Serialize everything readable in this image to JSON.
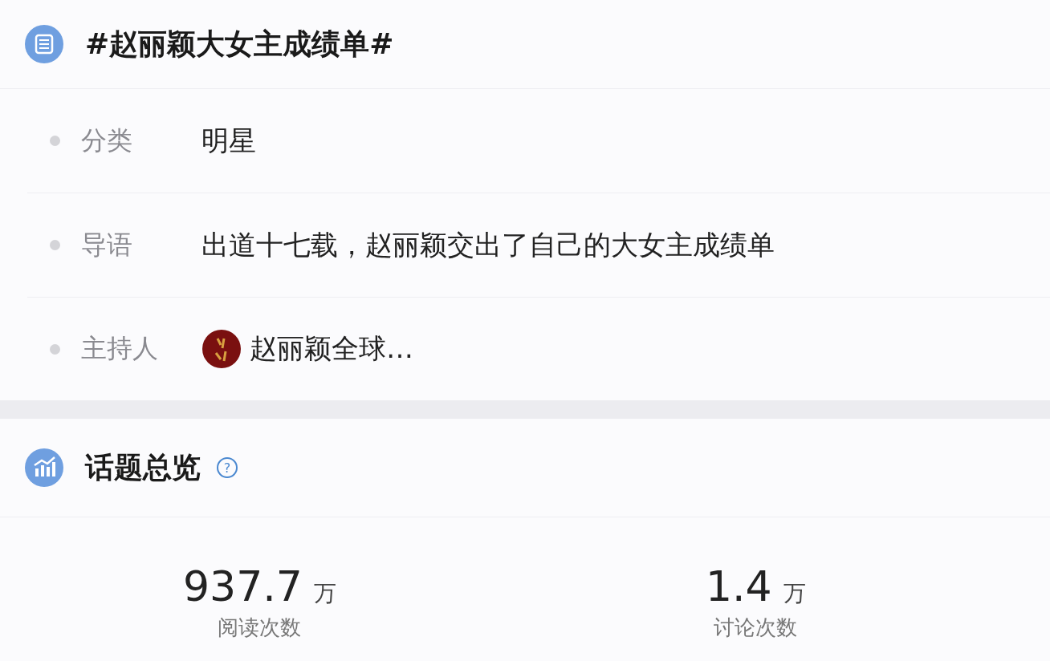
{
  "topic": {
    "title": "#赵丽颖大女主成绩单#"
  },
  "details": [
    {
      "label": "分类",
      "value": "明星",
      "kind": "text"
    },
    {
      "label": "导语",
      "value": "出道十七载，赵丽颖交出了自己的大女主成绩单",
      "kind": "text"
    },
    {
      "label": "主持人",
      "value": "赵丽颖全球…",
      "kind": "host"
    }
  ],
  "overview": {
    "title": "话题总览",
    "help": "?"
  },
  "stats": [
    {
      "number": "937.7",
      "unit": "万",
      "label": "阅读次数"
    },
    {
      "number": "1.4",
      "unit": "万",
      "label": "讨论次数"
    }
  ]
}
